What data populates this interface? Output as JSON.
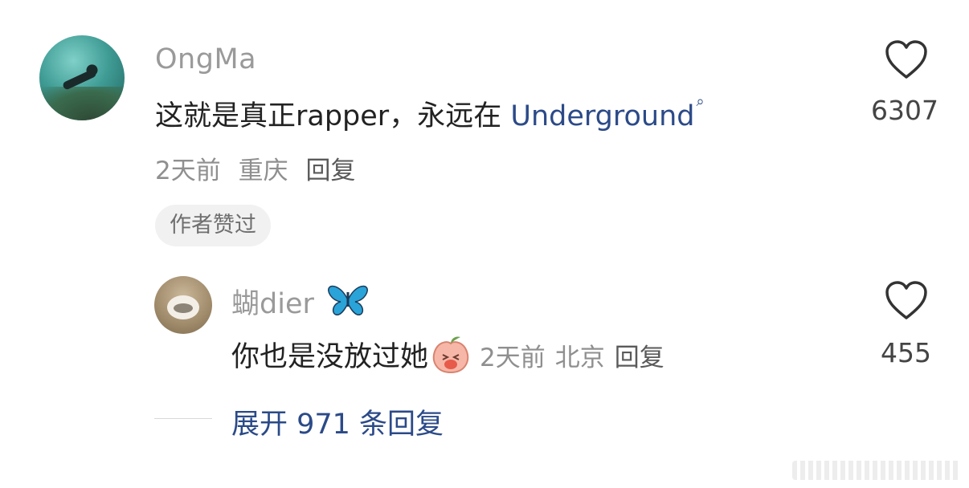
{
  "colors": {
    "link": "#2b4a88",
    "meta": "#8f8f8f",
    "username": "#9a9a9a",
    "text": "#222222"
  },
  "comment": {
    "username": "OngMa",
    "text_prefix": "这就是真正rapper，永远在 ",
    "text_link": "Underground",
    "search_icon": "search-icon",
    "meta": {
      "time": "2天前",
      "location": "重庆",
      "reply": "回复"
    },
    "badge": "作者赞过",
    "likes": "6307",
    "like_icon": "heart-outline-icon"
  },
  "reply": {
    "username": "蝴dier",
    "username_emoji": "butterfly-icon",
    "text": "你也是没放过她",
    "sticker": "laughing-peach-sticker",
    "meta": {
      "time": "2天前",
      "location": "北京",
      "reply": "回复"
    },
    "likes": "455",
    "like_icon": "heart-outline-icon"
  },
  "expand": {
    "label": "展开 971 条回复"
  }
}
